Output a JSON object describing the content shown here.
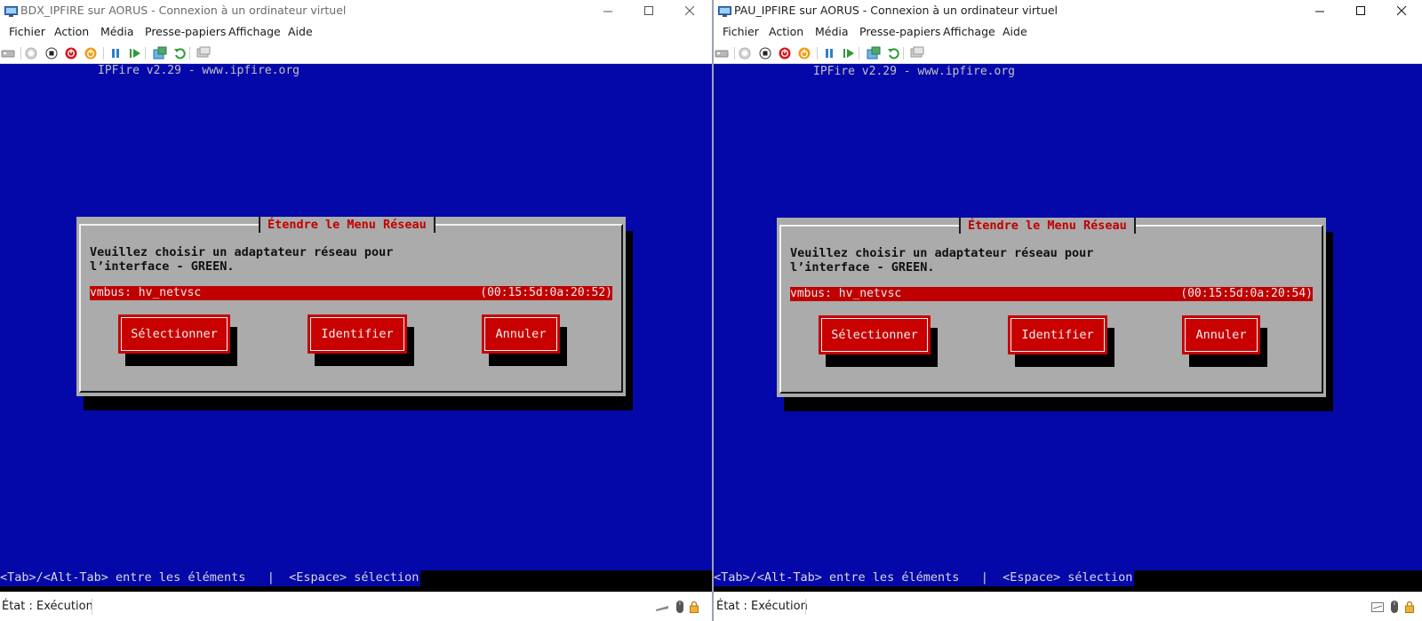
{
  "windows": [
    {
      "title": "BDX_IPFIRE sur AORUS - Connexion à un ordinateur virtuel",
      "menu": [
        "Fichier",
        "Action",
        "Média",
        "Presse-papiers",
        "Affichage",
        "Aide"
      ],
      "banner": "IPFire v2.29 - www.ipfire.org",
      "dialog": {
        "title": "Étendre le Menu Réseau",
        "prompt_line1": "Veuillez choisir un adaptateur réseau pour",
        "prompt_line2": "l’interface - GREEN.",
        "adapter_name": "vmbus: hv_netvsc",
        "adapter_mac": "(00:15:5d:0a:20:52)",
        "buttons": [
          "Sélectionner",
          "Identifier",
          "Annuler"
        ]
      },
      "help_text": "<Tab>/<Alt-Tab> entre les éléments   |  <Espace> sélection",
      "status": "État : Exécution"
    },
    {
      "title": "PAU_IPFIRE sur AORUS - Connexion à un ordinateur virtuel",
      "menu": [
        "Fichier",
        "Action",
        "Média",
        "Presse-papiers",
        "Affichage",
        "Aide"
      ],
      "banner": "IPFire v2.29 - www.ipfire.org",
      "dialog": {
        "title": "Étendre le Menu Réseau",
        "prompt_line1": "Veuillez choisir un adaptateur réseau pour",
        "prompt_line2": "l’interface - GREEN.",
        "adapter_name": "vmbus: hv_netvsc",
        "adapter_mac": "(00:15:5d:0a:20:54)",
        "buttons": [
          "Sélectionner",
          "Identifier",
          "Annuler"
        ]
      },
      "help_text": "<Tab>/<Alt-Tab> entre les éléments   |  <Espace> sélection",
      "status": "État : Exécution"
    }
  ],
  "colors": {
    "console_bg": "#0408a8",
    "dialog_bg": "#ababab",
    "accent_red": "#c00000",
    "title_red": "#c00000"
  },
  "icons": {
    "toolbar": [
      "ctrl-alt-del-icon",
      "start-icon",
      "turn-off-icon",
      "shutdown-icon",
      "save-icon",
      "pause-icon",
      "resume-icon",
      "checkpoint-icon",
      "revert-icon",
      "enhanced-session-icon"
    ],
    "caption": [
      "minimize-icon",
      "maximize-icon",
      "close-icon"
    ]
  }
}
